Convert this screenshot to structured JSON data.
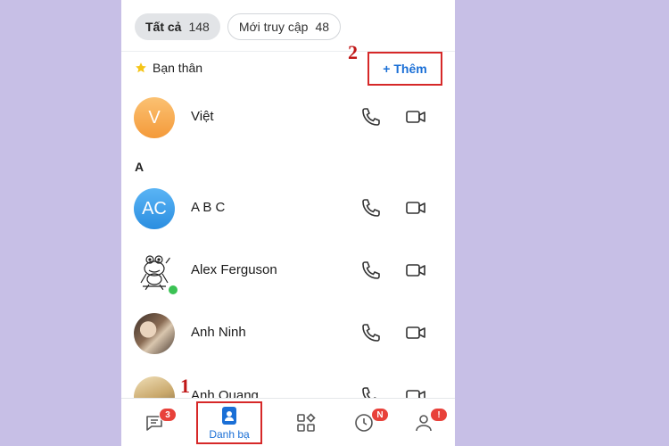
{
  "filters": {
    "all_label": "Tất cả",
    "all_count": "148",
    "recent_label": "Mới truy cập",
    "recent_count": "48"
  },
  "favorites": {
    "section_label": "Bạn thân",
    "add_label": "+ Thêm"
  },
  "markers": {
    "one": "1",
    "two": "2"
  },
  "sections": {
    "letter_a": "A"
  },
  "contacts": [
    {
      "name": "Việt",
      "avatar_text": "V"
    },
    {
      "name": "A B C",
      "avatar_text": "AC"
    },
    {
      "name": "Alex Ferguson"
    },
    {
      "name": "Anh Ninh"
    },
    {
      "name": "Anh Quang"
    }
  ],
  "nav": {
    "messages_badge": "3",
    "contacts_label": "Danh bạ",
    "timeline_badge": "N",
    "profile_badge": "!"
  },
  "colors": {
    "accent": "#1a6fd6",
    "annotation": "#d62828",
    "background": "#c7bfe6"
  },
  "icons": {
    "star": "star-icon",
    "call": "phone-icon",
    "video": "video-camera-icon",
    "messages": "chat-bubble-icon",
    "contacts": "contact-book-icon",
    "discover": "grid-shapes-icon",
    "timeline": "clock-icon",
    "profile": "person-icon"
  }
}
